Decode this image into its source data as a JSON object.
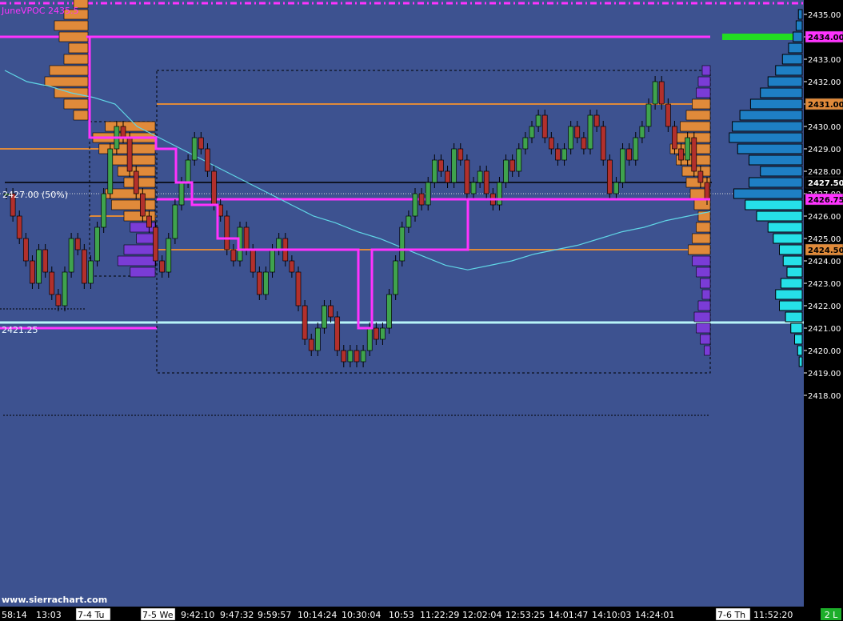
{
  "chart_data": {
    "type": "candlestick",
    "ylim": [
      2417.5,
      2435.6
    ],
    "y_ticks": [
      "2435.00",
      "2434.00",
      "2433.00",
      "2432.00",
      "2431.00",
      "2430.00",
      "2429.00",
      "2428.00",
      "2427.00",
      "2426.00",
      "2425.00",
      "2424.00",
      "2423.00",
      "2422.00",
      "2421.00",
      "2420.00",
      "2419.00",
      "2418.00"
    ],
    "time_labels": [
      "58:14",
      "13:03",
      "7-4 Tu",
      "7-5 We",
      "9:42:10",
      "9:47:32",
      "9:59:57",
      "10:14:24",
      "10:30:04",
      "10:53",
      "11:22:29",
      "12:02:04",
      "12:53:25",
      "14:01:47",
      "14:10:03",
      "14:24:01",
      "7-6 Th",
      "11:52:20"
    ],
    "day_markers": [
      "7-4 Tu",
      "7-5 We",
      "7-6 Th"
    ],
    "annotations": {
      "june_vpoc": "JuneVPOC 2435.5",
      "midpoint": "2427.00  (50%)",
      "low_line": "2421.25",
      "watermark": "www.sierrachart.com",
      "corner": "2 L"
    },
    "price_markers": [
      {
        "text": "2434.00",
        "value": 2434.0,
        "color": "#ff33ff",
        "text_color": "#000000"
      },
      {
        "text": "2431.00",
        "value": 2431.0,
        "color": "#e08a3a",
        "text_color": "#000000"
      },
      {
        "text": "2427.50",
        "value": 2427.5,
        "color": "#000000",
        "text_color": "#ffffff"
      },
      {
        "text": "2426.75",
        "value": 2426.75,
        "color": "#ff33ff",
        "text_color": "#000000"
      },
      {
        "text": "2424.50",
        "value": 2424.5,
        "color": "#e08a3a",
        "text_color": "#000000"
      }
    ],
    "levels": {
      "june_vpoc": 2435.5,
      "prior_poc": 2434.0,
      "value_area_high": 2431.0,
      "prior_va_high": 2430.0,
      "last_price": 2427.5,
      "midpoint_50": 2427.0,
      "current_poc": 2426.75,
      "value_area_low": 2424.5,
      "prior_low": 2421.0,
      "weekly_low": 2421.25,
      "session_range_high": 2432.5,
      "session_range_low": 2419.0,
      "lower_dotted": 2417.5
    },
    "price_series": [
      2427.0,
      2426.0,
      2425.0,
      2424.0,
      2423.0,
      2424.5,
      2423.5,
      2422.5,
      2422.0,
      2423.5,
      2425.0,
      2424.5,
      2423.0,
      2424.0,
      2425.5,
      2427.0,
      2429.0,
      2430.0,
      2429.5,
      2428.0,
      2427.0,
      2426.0,
      2425.5,
      2424.0,
      2423.5,
      2425.0,
      2426.5,
      2427.5,
      2428.5,
      2429.5,
      2429.0,
      2428.0,
      2426.5,
      2426.0,
      2424.5,
      2424.0,
      2425.5,
      2424.5,
      2423.5,
      2422.5,
      2423.5,
      2424.5,
      2425.0,
      2424.0,
      2423.5,
      2422.0,
      2420.5,
      2420.0,
      2421.0,
      2422.0,
      2421.5,
      2420.0,
      2419.5,
      2420.0,
      2419.5,
      2420.0,
      2421.0,
      2420.5,
      2421.0,
      2422.5,
      2424.0,
      2425.5,
      2426.0,
      2427.0,
      2426.5,
      2427.5,
      2428.5,
      2428.0,
      2427.5,
      2429.0,
      2428.5,
      2427.0,
      2427.5,
      2428.0,
      2427.0,
      2426.5,
      2427.5,
      2428.5,
      2428.0,
      2429.0,
      2429.5,
      2430.0,
      2430.5,
      2429.5,
      2429.0,
      2428.5,
      2429.0,
      2430.0,
      2429.5,
      2429.0,
      2430.5,
      2430.0,
      2428.5,
      2427.0,
      2427.5,
      2429.0,
      2428.5,
      2429.5,
      2430.0,
      2431.0,
      2432.0,
      2431.0,
      2430.0,
      2429.0,
      2428.5,
      2429.5,
      2428.0,
      2427.5,
      2426.75
    ],
    "vwap_series": [
      2432.5,
      2432.0,
      2431.8,
      2431.5,
      2431.3,
      2431.0,
      2430.0,
      2429.5,
      2429.0,
      2428.5,
      2428.0,
      2427.5,
      2427.0,
      2426.5,
      2426.0,
      2425.7,
      2425.3,
      2425.0,
      2424.6,
      2424.2,
      2423.8,
      2423.6,
      2423.8,
      2424.0,
      2424.3,
      2424.5,
      2424.7,
      2425.0,
      2425.3,
      2425.5,
      2425.8,
      2426.0,
      2426.2
    ],
    "volume_profile_right": [
      0.05,
      0.08,
      0.12,
      0.18,
      0.26,
      0.35,
      0.45,
      0.55,
      0.68,
      0.82,
      0.92,
      0.96,
      0.85,
      0.7,
      0.55,
      0.7,
      0.9,
      0.75,
      0.6,
      0.45,
      0.38,
      0.3,
      0.25,
      0.2,
      0.28,
      0.35,
      0.3,
      0.22,
      0.15,
      0.1,
      0.06,
      0.04
    ],
    "volume_profile_session": [
      0.2,
      0.3,
      0.35,
      0.45,
      0.6,
      0.75,
      0.9,
      1.0,
      0.85,
      0.7,
      0.6,
      0.5,
      0.4,
      0.3,
      0.35,
      0.45,
      0.55,
      0.45,
      0.35,
      0.25,
      0.2,
      0.3,
      0.4,
      0.35,
      0.25,
      0.15
    ],
    "colors": {
      "background": "#3d5290",
      "axis_background": "#000000",
      "up_candle": "#3fa34d",
      "down_candle": "#b2302c",
      "wick": "#000000",
      "vwap": "#60d6e6",
      "poc_magenta": "#ff33ff",
      "value_area_orange": "#e08a3a",
      "profile_orange": "#e08a3a",
      "profile_purple": "#7a3cd6",
      "profile_blue": "#1e7fc4",
      "profile_cyan": "#26e0e8",
      "low_line_cyan": "#b8f4f8",
      "green_bar": "#22dd22"
    }
  }
}
